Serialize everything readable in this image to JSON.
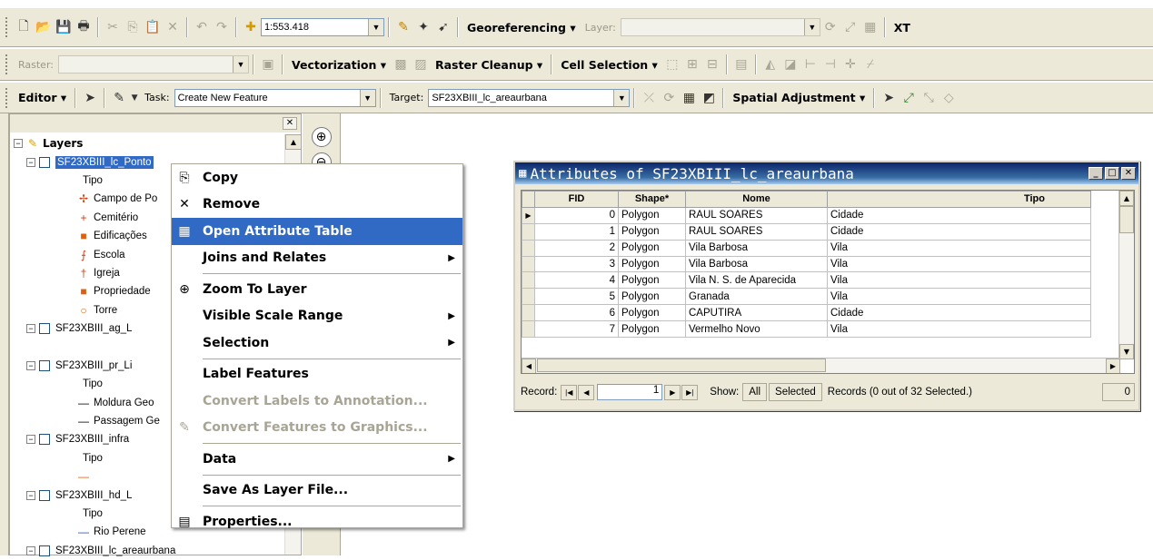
{
  "toolbar1": {
    "scale_value": "1:553.418",
    "georef_label": "Georeferencing ▾",
    "layer_label": "Layer:",
    "extra_label": "XT"
  },
  "toolbar2": {
    "raster_label": "Raster:",
    "vectorization_label": "Vectorization ▾",
    "raster_cleanup_label": "Raster Cleanup ▾",
    "cell_selection_label": "Cell Selection ▾"
  },
  "toolbar3": {
    "editor_label": "Editor ▾",
    "task_label": "Task:",
    "task_value": "Create New Feature",
    "target_label": "Target:",
    "target_value": "SF23XBIII_lc_areaurbana",
    "spatial_adjustment_label": "Spatial Adjustment ▾"
  },
  "toc": {
    "layers_label": "Layers",
    "rows": [
      {
        "text": "SF23XBIII_lc_Ponto",
        "kind": "layer-selected"
      },
      {
        "text": "Tipo",
        "kind": "field"
      },
      {
        "text": "Campo de Po",
        "kind": "sym",
        "icon": "✢",
        "color": "#d04010"
      },
      {
        "text": "Cemitério",
        "kind": "sym",
        "icon": "+",
        "color": "#d04010"
      },
      {
        "text": "Edificações",
        "kind": "sym",
        "icon": "■",
        "color": "#e06010"
      },
      {
        "text": "Escola",
        "kind": "sym",
        "icon": "⨍",
        "color": "#d04010"
      },
      {
        "text": "Igreja",
        "kind": "sym",
        "icon": "†",
        "color": "#d04010"
      },
      {
        "text": "Propriedade",
        "kind": "sym",
        "icon": "■",
        "color": "#e06010"
      },
      {
        "text": "Torre",
        "kind": "sym",
        "icon": "○",
        "color": "#e06010"
      },
      {
        "text": "SF23XBIII_ag_L",
        "kind": "layer"
      },
      {
        "text": "",
        "kind": "blank"
      },
      {
        "text": "SF23XBIII_pr_Li",
        "kind": "layer"
      },
      {
        "text": "Tipo",
        "kind": "field"
      },
      {
        "text": "Moldura Geo",
        "kind": "sym",
        "icon": "—",
        "color": "#000000"
      },
      {
        "text": "Passagem Ge",
        "kind": "sym",
        "icon": "—",
        "color": "#000000"
      },
      {
        "text": "SF23XBIII_infra",
        "kind": "layer"
      },
      {
        "text": "Tipo",
        "kind": "field"
      },
      {
        "text": "",
        "kind": "sym",
        "icon": "—",
        "color": "#e06010"
      },
      {
        "text": "SF23XBIII_hd_L",
        "kind": "layer"
      },
      {
        "text": "Tipo",
        "kind": "field"
      },
      {
        "text": "Rio Perene",
        "kind": "sym",
        "icon": "—",
        "color": "#2050c0"
      },
      {
        "text": "SF23XBIII_lc_areaurbana",
        "kind": "layer"
      }
    ]
  },
  "context_menu": {
    "items": [
      {
        "label": "Copy",
        "icon": "⎘",
        "state": "normal",
        "sub": false
      },
      {
        "label": "Remove",
        "icon": "✕",
        "state": "normal",
        "sub": false
      },
      {
        "label": "Open Attribute Table",
        "icon": "▦",
        "state": "highlighted",
        "sub": false
      },
      {
        "label": "Joins and Relates",
        "icon": "",
        "state": "normal",
        "sub": true
      },
      {
        "label": "Zoom To Layer",
        "icon": "⊕",
        "state": "normal",
        "sub": false
      },
      {
        "label": "Visible Scale Range",
        "icon": "",
        "state": "normal",
        "sub": true
      },
      {
        "label": "Selection",
        "icon": "",
        "state": "normal",
        "sub": true
      },
      {
        "label": "Label Features",
        "icon": "",
        "state": "normal",
        "sub": false
      },
      {
        "label": "Convert Labels to Annotation...",
        "icon": "",
        "state": "disabled",
        "sub": false
      },
      {
        "label": "Convert Features to Graphics...",
        "icon": "✎",
        "state": "disabled",
        "sub": false
      },
      {
        "label": "Data",
        "icon": "",
        "state": "normal",
        "sub": true
      },
      {
        "label": "Save As Layer File...",
        "icon": "",
        "state": "normal",
        "sub": false
      },
      {
        "label": "Properties...",
        "icon": "▤",
        "state": "normal",
        "sub": false
      }
    ]
  },
  "attribute_window": {
    "title": "Attributes of SF23XBIII_lc_areaurbana",
    "columns": [
      "FID",
      "Shape*",
      "Nome",
      "Tipo"
    ],
    "rows": [
      [
        "0",
        "Polygon",
        "RAUL SOARES",
        "Cidade"
      ],
      [
        "1",
        "Polygon",
        "RAUL SOARES",
        "Cidade"
      ],
      [
        "2",
        "Polygon",
        "Vila Barbosa",
        "Vila"
      ],
      [
        "3",
        "Polygon",
        "Vila Barbosa",
        "Vila"
      ],
      [
        "4",
        "Polygon",
        "Vila N. S. de Aparecida",
        "Vila"
      ],
      [
        "5",
        "Polygon",
        "Granada",
        "Vila"
      ],
      [
        "6",
        "Polygon",
        "CAPUTIRA",
        "Cidade"
      ],
      [
        "7",
        "Polygon",
        "Vermelho Novo",
        "Vila"
      ]
    ],
    "record_label": "Record:",
    "record_value": "1",
    "show_label": "Show:",
    "all_label": "All",
    "selected_label": "Selected",
    "records_text": "Records (0 out of 32 Selected.)",
    "right_value": "0"
  }
}
